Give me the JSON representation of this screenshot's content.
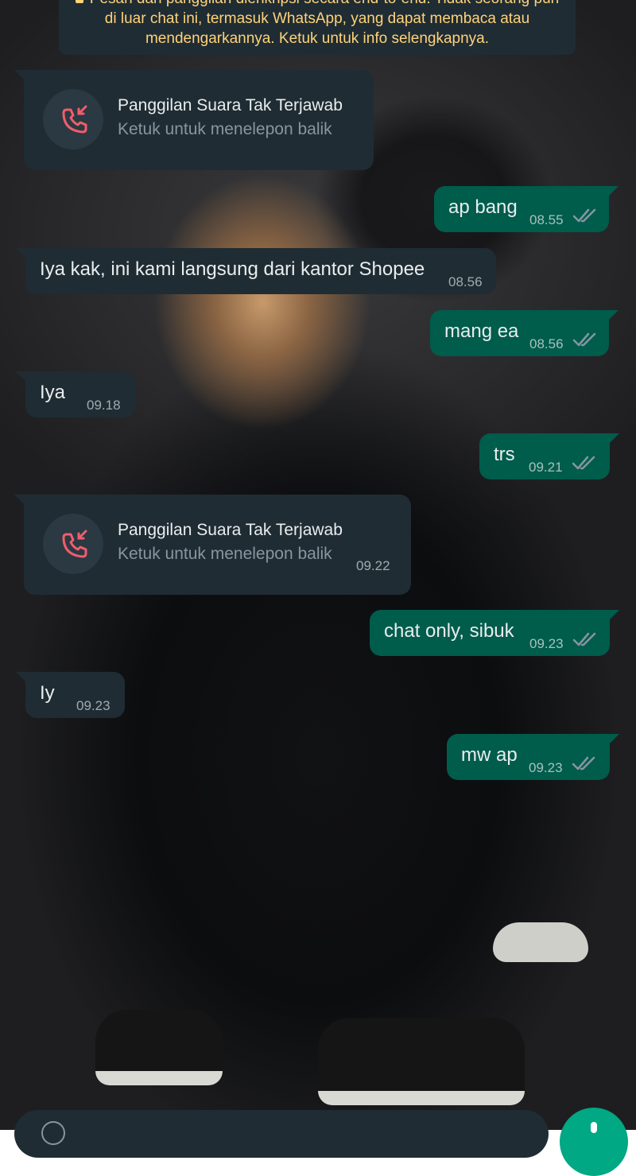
{
  "banner": {
    "text": "Pesan dan panggilan dienkripsi secara end-to-end. Tidak seorang pun di luar chat ini, termasuk WhatsApp, yang dapat membaca atau mendengarkannya. Ketuk untuk info selengkapnya.",
    "icon": "lock-icon"
  },
  "messages": [
    {
      "type": "call",
      "dir": "in",
      "title": "Panggilan Suara Tak Terjawab",
      "subtitle": "Ketuk untuk menelepon balik",
      "time": ""
    },
    {
      "type": "text",
      "dir": "out",
      "text": "ap bang",
      "time": "08.55"
    },
    {
      "type": "text",
      "dir": "in",
      "text": "Iya kak, ini kami langsung dari kantor Shopee",
      "time": "08.56"
    },
    {
      "type": "text",
      "dir": "out",
      "text": "mang ea",
      "time": "08.56"
    },
    {
      "type": "text",
      "dir": "in",
      "text": "Iya",
      "time": "09.18"
    },
    {
      "type": "text",
      "dir": "out",
      "text": "trs",
      "time": "09.21"
    },
    {
      "type": "call",
      "dir": "in",
      "title": "Panggilan Suara Tak Terjawab",
      "subtitle": "Ketuk untuk menelepon balik",
      "time": "09.22"
    },
    {
      "type": "text",
      "dir": "out",
      "text": "chat only, sibuk",
      "time": "09.23"
    },
    {
      "type": "text",
      "dir": "in",
      "text": "Iy",
      "time": "09.23"
    },
    {
      "type": "text",
      "dir": "out",
      "text": "mw ap",
      "time": "09.23"
    }
  ],
  "colors": {
    "incoming_bubble": "#1f2c33",
    "outgoing_bubble": "#005c4b",
    "missed_call_red": "#f15c6d",
    "read_tick": "#8696a0",
    "accent": "#00a884",
    "banner_text": "#ffd279"
  },
  "icons": {
    "missed_call": "missed-call-icon",
    "read_receipt": "double-check-icon",
    "composer_emoji": "emoji-icon",
    "send": "mic-icon"
  }
}
